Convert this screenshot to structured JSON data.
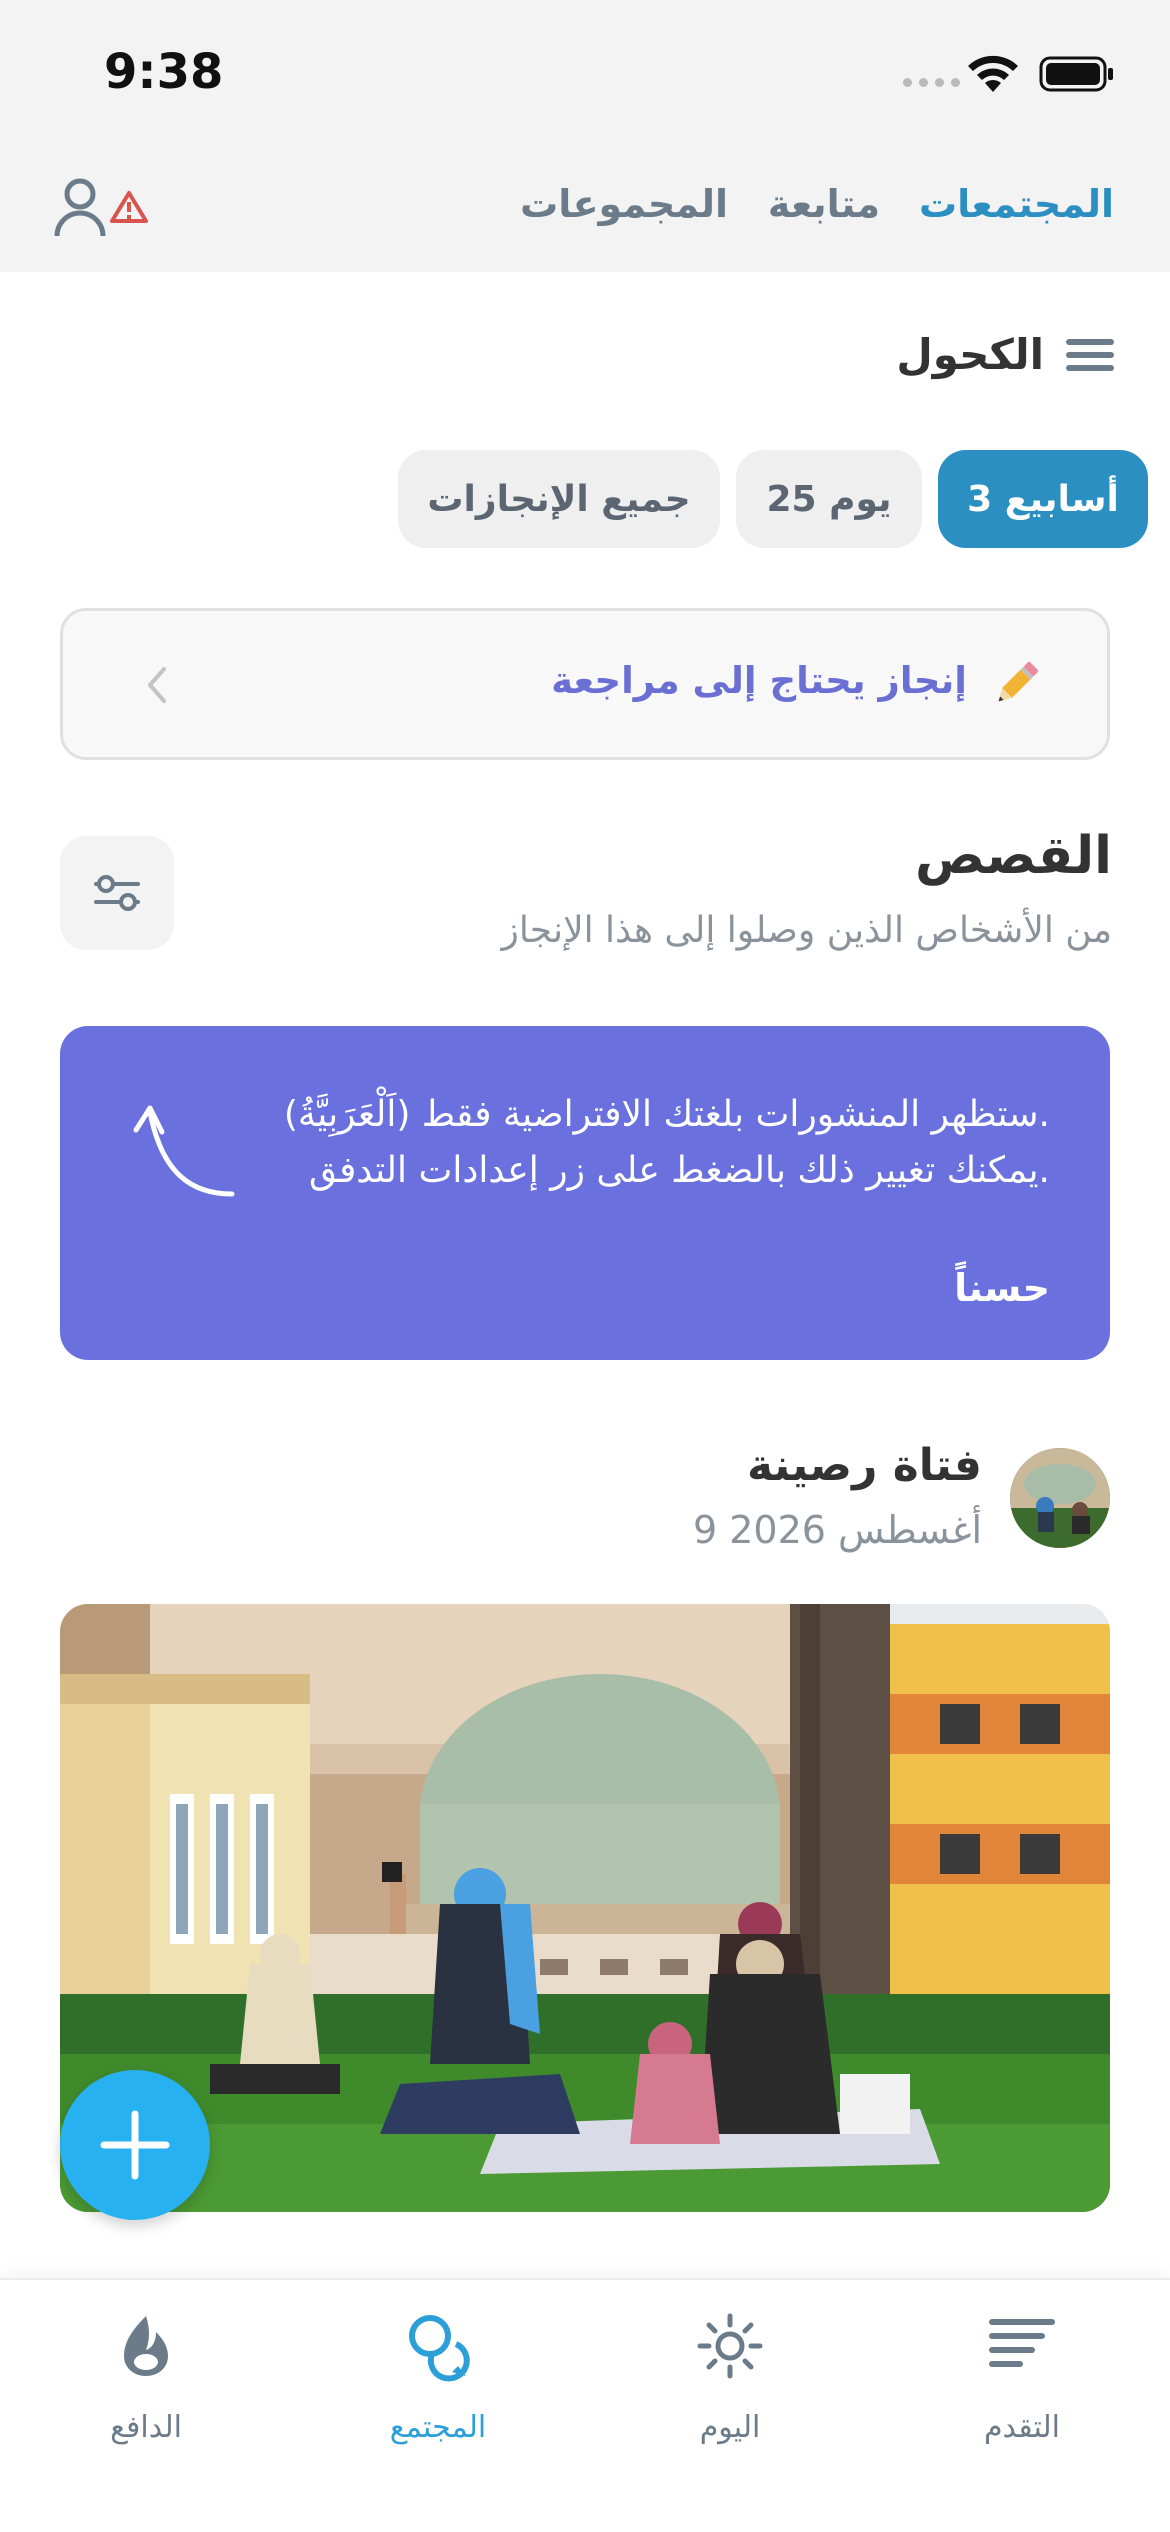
{
  "status_bar": {
    "time": "9:38"
  },
  "header": {
    "tabs": [
      {
        "label": "المجتمعات",
        "active": true
      },
      {
        "label": "متابعة",
        "active": false
      },
      {
        "label": "المجموعات",
        "active": false
      }
    ]
  },
  "addiction": {
    "title": "الكحول"
  },
  "filters": [
    {
      "label": "3 أسابيع",
      "active": true
    },
    {
      "label": "25 يوم",
      "active": false
    },
    {
      "label": "جميع الإنجازات",
      "active": false
    }
  ],
  "review_card": {
    "text": "إنجاز يحتاج إلى مراجعة"
  },
  "stories": {
    "title": "القصص",
    "subtitle": "من الأشخاص الذين وصلوا إلى هذا الإنجاز"
  },
  "banner": {
    "line1": "ستظهر المنشورات بلغتك الافتراضية فقط (اَلْعَرَبِيَّةُ).",
    "line2": "يمكنك تغيير ذلك بالضغط على زر إعدادات التدفق.",
    "ok_label": "حسناً"
  },
  "post": {
    "author": "فتاة رصينة",
    "date": "9 أغسطس 2026"
  },
  "bottom_nav": [
    {
      "label": "الدافع",
      "icon": "flame-icon",
      "active": false
    },
    {
      "label": "المجتمع",
      "icon": "chat-bubbles-icon",
      "active": true
    },
    {
      "label": "اليوم",
      "icon": "sun-icon",
      "active": false
    },
    {
      "label": "التقدم",
      "icon": "progress-bars-icon",
      "active": false
    }
  ],
  "colors": {
    "accent": "#2c8fc1",
    "banner": "#6a70dd",
    "fab": "#27b1f0",
    "review_text": "#6a6fd3"
  }
}
